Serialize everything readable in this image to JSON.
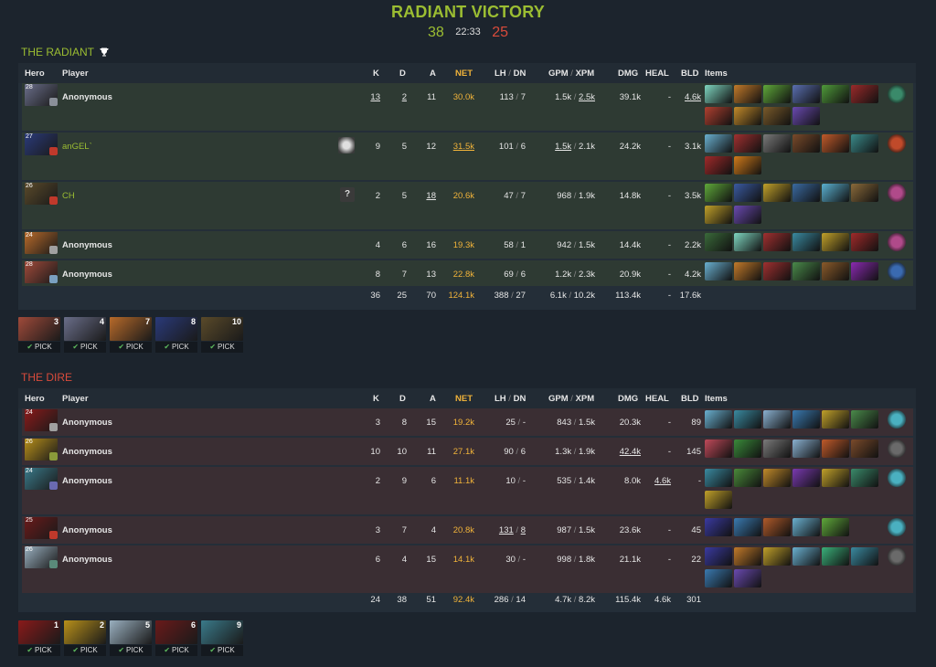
{
  "match": {
    "result": "RADIANT VICTORY",
    "radiant_score": "38",
    "duration": "22:33",
    "dire_score": "25"
  },
  "colors": {
    "radiant": "#9bbd32",
    "dire": "#d94b3b",
    "net": "#f0b33a"
  },
  "columns": {
    "hero": "Hero",
    "player": "Player",
    "k": "K",
    "d": "D",
    "a": "A",
    "net": "NET",
    "lh": "LH",
    "dn": "DN",
    "gpm": "GPM",
    "xpm": "XPM",
    "dmg": "DMG",
    "heal": "HEAL",
    "bld": "BLD",
    "items": "Items",
    "sep": "/"
  },
  "radiant": {
    "title": "THE RADIANT",
    "trophy_icon": "trophy-icon",
    "players": [
      {
        "level": "28",
        "name": "Anonymous",
        "named": false,
        "k": "13",
        "d": "2",
        "a": "11",
        "net": "30.0k",
        "lh": "113",
        "dn": "7",
        "gpm": "1.5k",
        "xpm": "2.5k",
        "dmg": "39.1k",
        "heal": "-",
        "bld": "4.6k",
        "hero_color": "#6a6e8a",
        "badge_color": "#8a8f99",
        "items": [
          "#7fd6c0",
          "#c27a2a",
          "#5fa83a",
          "#5a6fb0",
          "#4f9a3a",
          "#9a2a2a",
          "#b04030",
          "#c28a2a",
          "#7a5a2a",
          "#6a4ab0"
        ],
        "neutral": "#3a8a6a"
      },
      {
        "level": "27",
        "name": "anGEL`",
        "named": true,
        "k": "9",
        "d": "5",
        "a": "12",
        "net": "31.5k",
        "lh": "101",
        "dn": "6",
        "gpm": "1.5k",
        "xpm": "2.1k",
        "dmg": "24.2k",
        "heal": "-",
        "bld": "3.1k",
        "hero_color": "#2a3a7a",
        "badge_color": "#c0392b",
        "items": [
          "#6ab0d0",
          "#a03030",
          "#7a7a7a",
          "#7a4a2a",
          "#c05a2a",
          "#3a8a8a",
          "#a02a2a",
          "#d07a1a"
        ],
        "neutral": "#c04a2a",
        "ally_color": "#e0e0e0"
      },
      {
        "level": "26",
        "name": "CH",
        "named": true,
        "k": "2",
        "d": "5",
        "a": "18",
        "net": "20.6k",
        "lh": "47",
        "dn": "7",
        "gpm": "968",
        "xpm": "1.9k",
        "dmg": "14.8k",
        "heal": "-",
        "bld": "3.5k",
        "hero_color": "#5a4a2a",
        "badge_color": "#c0392b",
        "items": [
          "#5fa83a",
          "#3a5aa0",
          "#c0a02a",
          "#3a6aa0",
          "#5ab0d0",
          "#8a6a3a",
          "#c0a02a",
          "#6a4ab0"
        ],
        "neutral": "#b04a8a",
        "question": "?"
      },
      {
        "level": "24",
        "name": "Anonymous",
        "named": false,
        "k": "4",
        "d": "6",
        "a": "16",
        "net": "19.3k",
        "lh": "58",
        "dn": "1",
        "gpm": "942",
        "xpm": "1.5k",
        "dmg": "14.4k",
        "heal": "-",
        "bld": "2.2k",
        "hero_color": "#b86a2a",
        "badge_color": "#a0a0a0",
        "items": [
          "#3a6a3a",
          "#7fd6c0",
          "#a03030",
          "#3a8aa0",
          "#c0a02a",
          "#a02a2a"
        ],
        "neutral": "#b04a8a"
      },
      {
        "level": "28",
        "name": "Anonymous",
        "named": false,
        "k": "8",
        "d": "7",
        "a": "13",
        "net": "22.8k",
        "lh": "69",
        "dn": "6",
        "gpm": "1.2k",
        "xpm": "2.3k",
        "dmg": "20.9k",
        "heal": "-",
        "bld": "4.2k",
        "hero_color": "#a04a3a",
        "badge_color": "#7aa0c0",
        "items": [
          "#6ab0d0",
          "#c27a2a",
          "#a03030",
          "#4a8a4a",
          "#8a5a2a",
          "#8a2ab0"
        ],
        "neutral": "#3a6ab0"
      }
    ],
    "totals": {
      "k": "36",
      "d": "25",
      "a": "70",
      "net": "124.1k",
      "lh": "388",
      "dn": "27",
      "gpm": "6.1k",
      "xpm": "10.2k",
      "dmg": "113.4k",
      "heal": "-",
      "bld": "17.6k"
    },
    "picks": [
      {
        "num": "3",
        "label": "PICK",
        "color": "#a04a3a"
      },
      {
        "num": "4",
        "label": "PICK",
        "color": "#6a6e8a"
      },
      {
        "num": "7",
        "label": "PICK",
        "color": "#b86a2a"
      },
      {
        "num": "8",
        "label": "PICK",
        "color": "#2a3a7a"
      },
      {
        "num": "10",
        "label": "PICK",
        "color": "#5a4a2a"
      }
    ]
  },
  "dire": {
    "title": "THE DIRE",
    "players": [
      {
        "level": "24",
        "name": "Anonymous",
        "named": false,
        "k": "3",
        "d": "8",
        "a": "15",
        "net": "19.2k",
        "lh": "25",
        "dn": "-",
        "gpm": "843",
        "xpm": "1.5k",
        "dmg": "20.3k",
        "heal": "-",
        "bld": "89",
        "hero_color": "#8a1a1a",
        "badge_color": "#a0a0a0",
        "items": [
          "#6ab0d0",
          "#3a8aa0",
          "#8ab0d0",
          "#3a7ab0",
          "#c0a02a",
          "#4a8a4a"
        ],
        "neutral": "#4ab0c0"
      },
      {
        "level": "26",
        "name": "Anonymous",
        "named": false,
        "k": "10",
        "d": "10",
        "a": "11",
        "net": "27.1k",
        "lh": "90",
        "dn": "6",
        "gpm": "1.3k",
        "xpm": "1.9k",
        "dmg": "42.4k",
        "heal": "-",
        "bld": "145",
        "hero_color": "#b8901a",
        "badge_color": "#8a9a3a",
        "items": [
          "#c04a5a",
          "#3a8a3a",
          "#7a7a7a",
          "#8ab0d0",
          "#c05a2a",
          "#7a4a2a"
        ],
        "neutral": "#6a6a6a"
      },
      {
        "level": "24",
        "name": "Anonymous",
        "named": false,
        "k": "2",
        "d": "9",
        "a": "6",
        "net": "11.1k",
        "lh": "10",
        "dn": "-",
        "gpm": "535",
        "xpm": "1.4k",
        "dmg": "8.0k",
        "heal": "4.6k",
        "bld": "-",
        "hero_color": "#3a7a8a",
        "badge_color": "#6a6ab0",
        "items": [
          "#3a8aa0",
          "#4a8a3a",
          "#c08a2a",
          "#7a3ab0",
          "#c0a02a",
          "#3a8a6a",
          "#c0a02a"
        ],
        "neutral": "#4ab0c0"
      },
      {
        "level": "25",
        "name": "Anonymous",
        "named": false,
        "k": "3",
        "d": "7",
        "a": "4",
        "net": "20.8k",
        "lh": "131",
        "dn": "8",
        "gpm": "987",
        "xpm": "1.5k",
        "dmg": "23.6k",
        "heal": "-",
        "bld": "45",
        "hero_color": "#6a1a1a",
        "badge_color": "#c0392b",
        "items": [
          "#3a3aa0",
          "#3a7ab0",
          "#b05a2a",
          "#6ab0d0",
          "#5fa83a"
        ],
        "neutral": "#4ab0c0"
      },
      {
        "level": "26",
        "name": "Anonymous",
        "named": false,
        "k": "6",
        "d": "4",
        "a": "15",
        "net": "14.1k",
        "lh": "30",
        "dn": "-",
        "gpm": "998",
        "xpm": "1.8k",
        "dmg": "21.1k",
        "heal": "-",
        "bld": "22",
        "hero_color": "#9ab0c0",
        "badge_color": "#5a8a7a",
        "items": [
          "#3a3aa0",
          "#c27a2a",
          "#c0a02a",
          "#6ab0d0",
          "#3ab07a",
          "#3a8aa0",
          "#3a7ab0",
          "#6a4ab0"
        ],
        "neutral": "#6a6a6a"
      }
    ],
    "totals": {
      "k": "24",
      "d": "38",
      "a": "51",
      "net": "92.4k",
      "lh": "286",
      "dn": "14",
      "gpm": "4.7k",
      "xpm": "8.2k",
      "dmg": "115.4k",
      "heal": "4.6k",
      "bld": "301"
    },
    "picks": [
      {
        "num": "1",
        "label": "PICK",
        "color": "#8a1a1a"
      },
      {
        "num": "2",
        "label": "PICK",
        "color": "#b8901a"
      },
      {
        "num": "5",
        "label": "PICK",
        "color": "#9ab0c0"
      },
      {
        "num": "6",
        "label": "PICK",
        "color": "#6a1a1a"
      },
      {
        "num": "9",
        "label": "PICK",
        "color": "#3a7a8a"
      }
    ]
  }
}
